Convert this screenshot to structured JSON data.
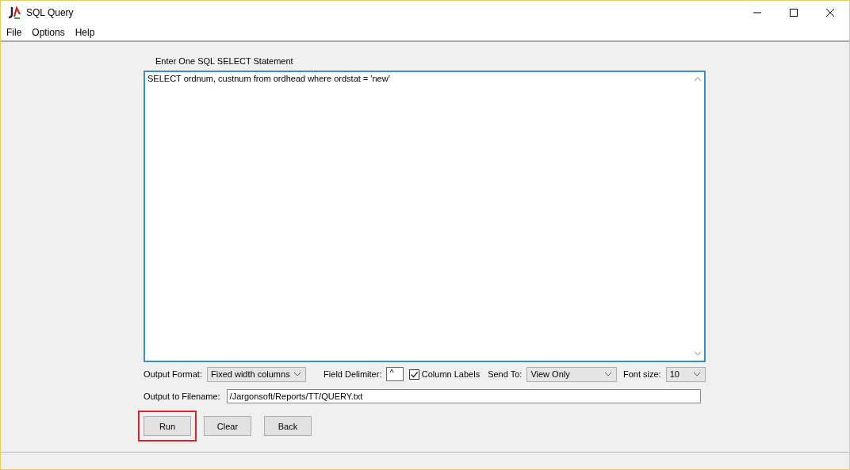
{
  "window": {
    "title": "SQL Query"
  },
  "menu": [
    "File",
    "Options",
    "Help"
  ],
  "statement": {
    "label": "Enter One SQL SELECT Statement",
    "value": "SELECT ordnum, custnum  from ordhead where ordstat = 'new'"
  },
  "output_format": {
    "label": "Output Format:",
    "value": "Fixed width columns"
  },
  "field_delimiter": {
    "label": "Field Delimiter:",
    "value": "^"
  },
  "column_labels": {
    "label": "Column Labels",
    "checked": true
  },
  "send_to": {
    "label": "Send To:",
    "value": "View Only"
  },
  "font_size": {
    "label": "Font size:",
    "value": "10"
  },
  "filename": {
    "label": "Output to Filename:",
    "value": "/Jargonsoft/Reports/TT/QUERY.txt"
  },
  "buttons": [
    {
      "label": "Run",
      "highlighted": true
    },
    {
      "label": "Clear",
      "highlighted": false
    },
    {
      "label": "Back",
      "highlighted": false
    }
  ]
}
